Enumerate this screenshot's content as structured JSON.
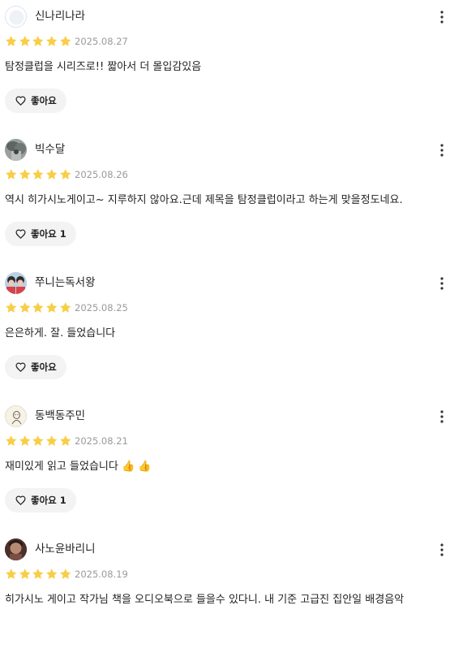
{
  "colors": {
    "star": "#F7CE46",
    "date": "#9A9A9A",
    "like_bg": "#F3F3F3",
    "text": "#222222"
  },
  "icons": {
    "star": "star-icon",
    "more": "more-vertical-icon",
    "like": "heart-outline-icon"
  },
  "reviews": [
    {
      "nickname": "신나리나라",
      "rating": 5,
      "date": "2025.08.27",
      "content": "탐정클럽을 시리즈로!! 짧아서 더 몰입감있음",
      "like_label": "좋아요",
      "like_count": ""
    },
    {
      "nickname": "빅수달",
      "rating": 5,
      "date": "2025.08.26",
      "content": "역시 히가시노게이고~ 지루하지 않아요.근데 제목을 탐정클럽이라고 하는게 맞을정도네요.",
      "like_label": "좋아요",
      "like_count": "1"
    },
    {
      "nickname": "쭈니는독서왕",
      "rating": 5,
      "date": "2025.08.25",
      "content": "은은하게.  잘. 들었습니다",
      "like_label": "좋아요",
      "like_count": ""
    },
    {
      "nickname": "동백동주민",
      "rating": 5,
      "date": "2025.08.21",
      "content": "재미있게 읽고 들었습니다 👍 👍",
      "like_label": "좋아요",
      "like_count": "1"
    },
    {
      "nickname": "사노윤바리니",
      "rating": 5,
      "date": "2025.08.19",
      "content": "히가시노 게이고 작가님 책을 오디오북으로 들을수 있다니. 내 기준 고급진  집안일 배경음악",
      "like_label": "좋아요",
      "like_count": ""
    }
  ]
}
